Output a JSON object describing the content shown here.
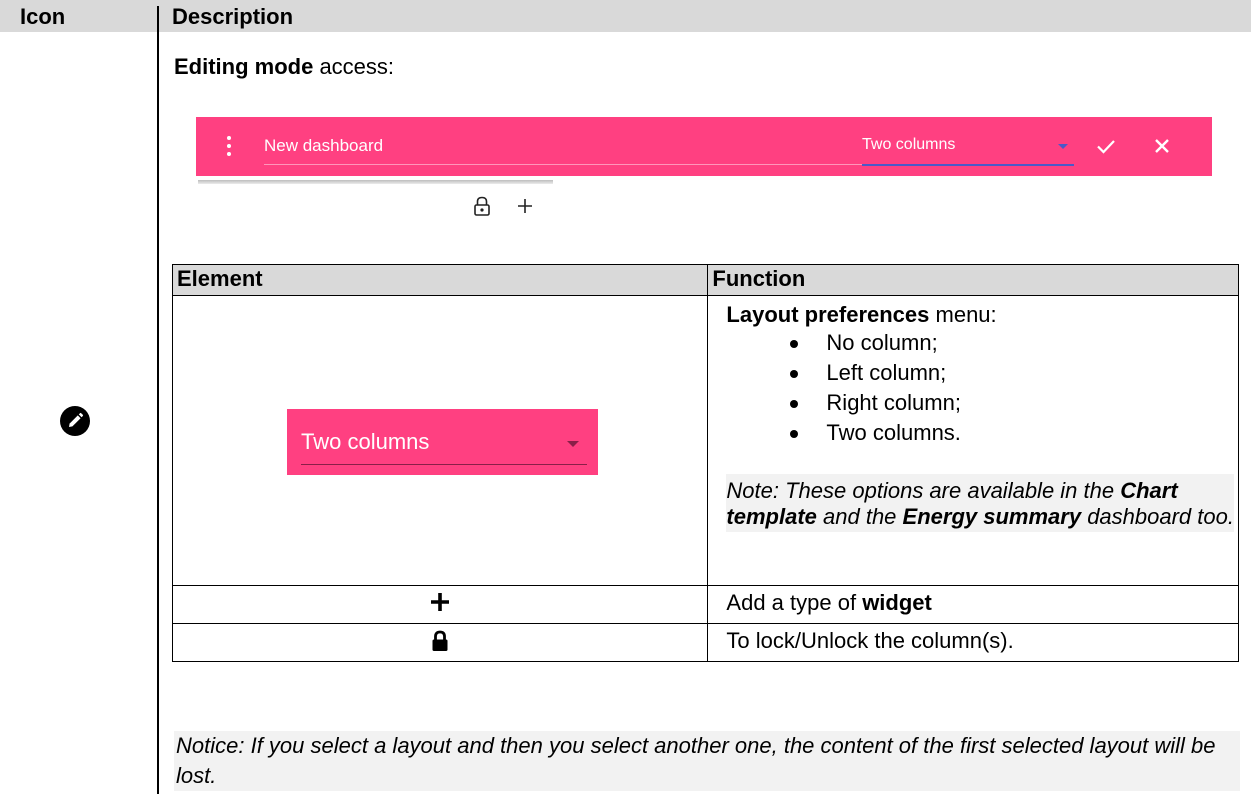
{
  "header": {
    "icon_col": "Icon",
    "desc_col": "Description"
  },
  "editing": {
    "title_bold": "Editing mode",
    "title_rest": " access:"
  },
  "toolbar": {
    "dashboard_name": "New dashboard",
    "layout_value": "Two columns",
    "accent_color": "#ff4081",
    "underline_color": "#4a59c9",
    "icons": [
      "more-vert-icon",
      "check-icon",
      "close-icon",
      "lock-icon",
      "plus-icon"
    ]
  },
  "table": {
    "col_element": "Element",
    "col_function": "Function",
    "layout_row": {
      "element_label": "Two columns",
      "function_title_bold": "Layout preferences",
      "function_title_rest": " menu:",
      "options": [
        "No column;",
        "Left column;",
        "Right column;",
        "Two columns."
      ],
      "note_prefix": "Note: These options are available in the ",
      "note_bold1": "Chart template",
      "note_mid": " and the ",
      "note_bold2": "Energy summary",
      "note_suffix": " dashboard too."
    },
    "add_row": {
      "text_prefix": "Add a type of ",
      "text_bold": "widget"
    },
    "lock_row": {
      "text": "To lock/Unlock the column(s)."
    }
  },
  "notice": "Notice: If you select a layout and then you select another one, the content of the first selected layout will be lost."
}
